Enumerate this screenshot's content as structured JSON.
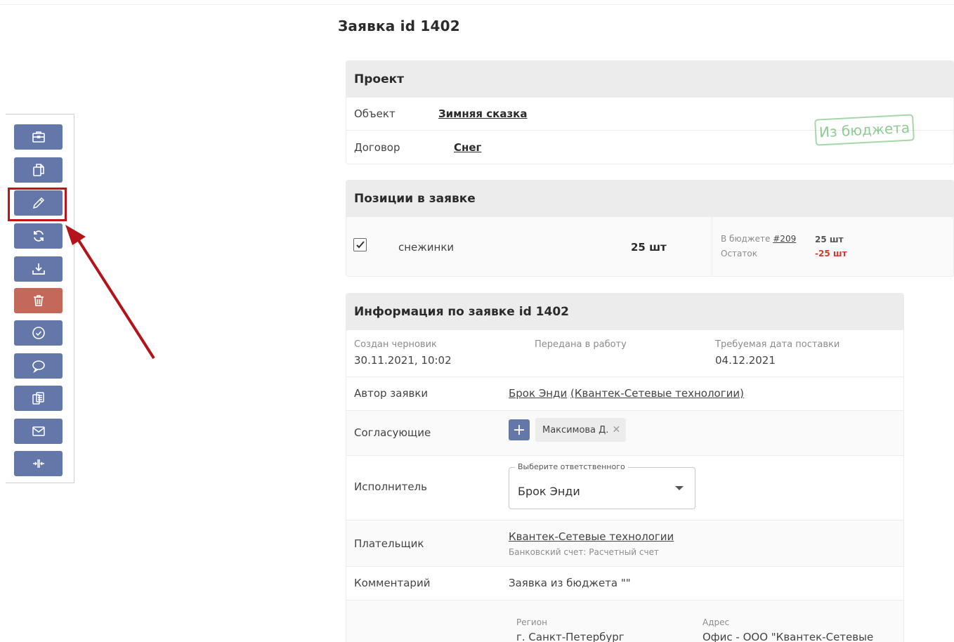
{
  "page_title": "Заявка id 1402",
  "toolbar": {
    "buttons": [
      {
        "name": "briefcase-icon",
        "label": ""
      },
      {
        "name": "copy-icon",
        "label": ""
      },
      {
        "name": "pencil-icon",
        "label": ""
      },
      {
        "name": "refresh-icon",
        "label": ""
      },
      {
        "name": "download-icon",
        "label": ""
      },
      {
        "name": "trash-icon",
        "label": ""
      },
      {
        "name": "check-circle-icon",
        "label": ""
      },
      {
        "name": "comment-icon",
        "label": ""
      },
      {
        "name": "documents-icon",
        "label": ""
      },
      {
        "name": "mail-icon",
        "label": ""
      },
      {
        "name": "split-icon",
        "label": ""
      }
    ],
    "highlight_color": "#c0141a",
    "button_color": "#6377a8",
    "danger_color": "#c4695a"
  },
  "project": {
    "heading": "Проект",
    "object_label": "Объект",
    "object_value": "Зимняя сказка",
    "contract_label": "Договор",
    "contract_value": "Снег",
    "stamp": "Из бюджета"
  },
  "positions": {
    "heading": "Позиции в заявке",
    "items": [
      {
        "checked": true,
        "name": "снежинки",
        "qty": "25 шт",
        "budget_label": "В бюджете",
        "budget_link": "#209",
        "budget_qty": "25 шт",
        "remainder_label": "Остаток",
        "remainder_qty": "-25 шт"
      }
    ]
  },
  "info": {
    "heading": "Информация по заявке id 1402",
    "draft_label": "Создан черновик",
    "draft_value": "30.11.2021, 10:02",
    "sent_label": "Передана в работу",
    "required_label": "Требуемая дата поставки",
    "required_value": "04.12.2021",
    "author_label": "Автор заявки",
    "author_name": "Брок Энди",
    "author_org": "(Квантек-Сетевые технологии)",
    "approvers_label": "Согласующие",
    "approver_chip": "Максимова Д.",
    "executor_label": "Исполнитель",
    "executor_legend": "Выберите ответственного",
    "executor_value": "Брок Энди",
    "payer_label": "Плательщик",
    "payer_value": "Квантек-Сетевые технологии",
    "payer_account": "Банковский счет: Расчетный счет",
    "comment_label": "Комментарий",
    "comment_value": "Заявка из бюджета \"\"",
    "region_label": "Регион",
    "region_value": "г. Санкт-Петербург",
    "address_label": "Адрес",
    "address_value": "Офис - ООО \"Квантек-Сетевые"
  }
}
